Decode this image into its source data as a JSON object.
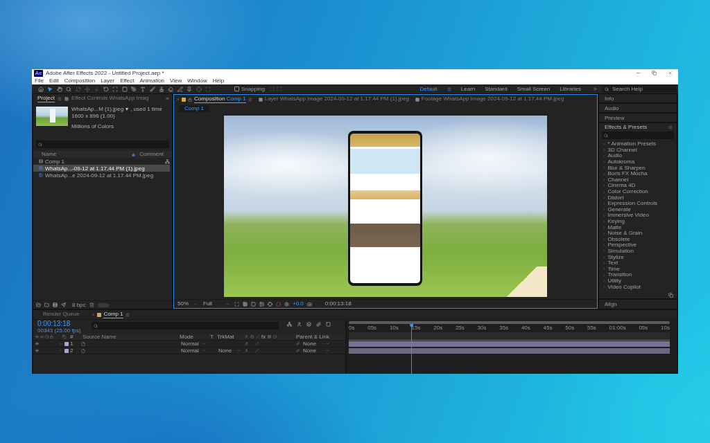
{
  "window": {
    "app_icon": "Ae",
    "title": "Adobe After Effects 2022 - Untitled Project.aep *"
  },
  "menu": [
    "File",
    "Edit",
    "Composition",
    "Layer",
    "Effect",
    "Animation",
    "View",
    "Window",
    "Help"
  ],
  "toolbar": {
    "tools": [
      {
        "kind": "home",
        "selected": false,
        "disabled": false
      },
      {
        "kind": "selection",
        "selected": true,
        "disabled": false
      },
      {
        "kind": "hand",
        "selected": false,
        "disabled": false
      },
      {
        "kind": "zoom",
        "selected": false,
        "disabled": false
      },
      {
        "kind": "orbit",
        "selected": false,
        "disabled": true
      },
      {
        "kind": "pan",
        "selected": false,
        "disabled": true
      },
      {
        "kind": "dolly",
        "selected": false,
        "disabled": true
      },
      {
        "kind": "rotation",
        "selected": false,
        "disabled": false
      },
      {
        "kind": "pan_behind",
        "selected": false,
        "disabled": false
      },
      {
        "kind": "rectangle",
        "selected": false,
        "disabled": false
      },
      {
        "kind": "pen",
        "selected": false,
        "disabled": false
      },
      {
        "kind": "type",
        "selected": false,
        "disabled": false
      },
      {
        "kind": "brush",
        "selected": false,
        "disabled": false
      },
      {
        "kind": "clone",
        "selected": false,
        "disabled": false
      },
      {
        "kind": "eraser",
        "selected": false,
        "disabled": false
      },
      {
        "kind": "roto",
        "selected": false,
        "disabled": false
      },
      {
        "kind": "puppet",
        "selected": false,
        "disabled": false
      },
      {
        "kind": "local_axis",
        "selected": false,
        "disabled": true
      },
      {
        "kind": "world_axis",
        "selected": false,
        "disabled": true
      }
    ],
    "snapping": {
      "label": "Snapping",
      "checked": false,
      "options": [
        {
          "kind": "snap_edges",
          "disabled": true
        },
        {
          "kind": "snap_features",
          "disabled": true
        }
      ]
    },
    "workspaces": [
      {
        "label": "Default",
        "selected": true
      },
      {
        "label": "Learn",
        "selected": false
      },
      {
        "label": "Standard",
        "selected": false
      },
      {
        "label": "Small Screen",
        "selected": false
      },
      {
        "label": "Libraries",
        "selected": false
      }
    ],
    "search": {
      "placeholder": "Search Help"
    }
  },
  "project_panel": {
    "tabs": [
      {
        "label": "Project",
        "selected": true
      },
      {
        "label": "Effect Controls WhatsApp Imag",
        "selected": false
      }
    ],
    "info": {
      "name": "WhatsAp...M (1).jpeg",
      "usage": ", used 1 time",
      "dimensions": "1600 x 896 (1.00)",
      "colors": "Millions of Colors"
    },
    "columns": {
      "name": "Name",
      "comment": "Comment"
    },
    "items": [
      {
        "kind": "composition",
        "name": "Comp 1",
        "selected": false
      },
      {
        "kind": "image",
        "name": "WhatsAp...-09-12 at 1.17.44 PM (1).jpeg",
        "selected": true
      },
      {
        "kind": "image",
        "name": "WhatsAp...e 2024-09-12 at 1.17.44 PM.jpeg",
        "selected": false
      }
    ],
    "bit_depth": "8 bpc"
  },
  "composition_panel": {
    "tabs": [
      {
        "kind": "composition",
        "label": "Composition",
        "name": "Comp 1",
        "selected": true
      },
      {
        "kind": "layer",
        "label": "Layer",
        "name": "WhatsApp Image 2024-09-12 at 1.17.44 PM (1).jpeg",
        "selected": false
      },
      {
        "kind": "footage",
        "label": "Footage",
        "name": "WhatsApp Image 2024-09-12 at 1.17.44 PM.jpeg",
        "selected": false
      }
    ],
    "breadcrumb": "Comp 1",
    "viewer_bar": {
      "zoom": "50%",
      "resolution": "Full",
      "exposure": "+0.0",
      "timecode": "0:00:13:18"
    }
  },
  "side_panels": [
    {
      "title": "Info"
    },
    {
      "title": "Audio"
    },
    {
      "title": "Preview"
    }
  ],
  "effects_presets": {
    "title": "Effects & Presets",
    "categories": [
      "* Animation Presets",
      "3D Channel",
      "Audio",
      "Autokroma",
      "Blur & Sharpen",
      "Boris FX Mocha",
      "Channel",
      "Cinema 4D",
      "Color Correction",
      "Distort",
      "Expression Controls",
      "Generate",
      "Immersive Video",
      "Keying",
      "Matte",
      "Noise & Grain",
      "Obsolete",
      "Perspective",
      "Simulation",
      "Stylize",
      "Text",
      "Time",
      "Transition",
      "Utility",
      "Video Copilot"
    ]
  },
  "align_panel": {
    "title": "Align"
  },
  "timeline": {
    "tabs": [
      {
        "kind": "render_queue",
        "label": "Render Queue",
        "selected": false
      },
      {
        "kind": "composition",
        "label": "Comp 1",
        "selected": true
      }
    ],
    "timecode": "0:00:13:18",
    "frame_info": "00343 (25.00 fps)",
    "columns": {
      "number": "#",
      "source_name": "Source Name",
      "mode": "Mode",
      "preserve": "T",
      "track_matte": "TrkMat",
      "effects": "fx",
      "parent": "Parent & Link"
    },
    "layers": [
      {
        "number": "1",
        "visible": true,
        "mode": "Normal",
        "parent": "None"
      },
      {
        "number": "2",
        "visible": true,
        "mode": "Normal",
        "track_matte": "None",
        "parent": "None"
      }
    ],
    "ruler": [
      "0s",
      "05s",
      "10s",
      "15s",
      "20s",
      "25s",
      "30s",
      "35s",
      "40s",
      "45s",
      "50s",
      "55s",
      "01:00s",
      "05s",
      "10s"
    ],
    "playhead": {
      "level": 0.196
    }
  }
}
